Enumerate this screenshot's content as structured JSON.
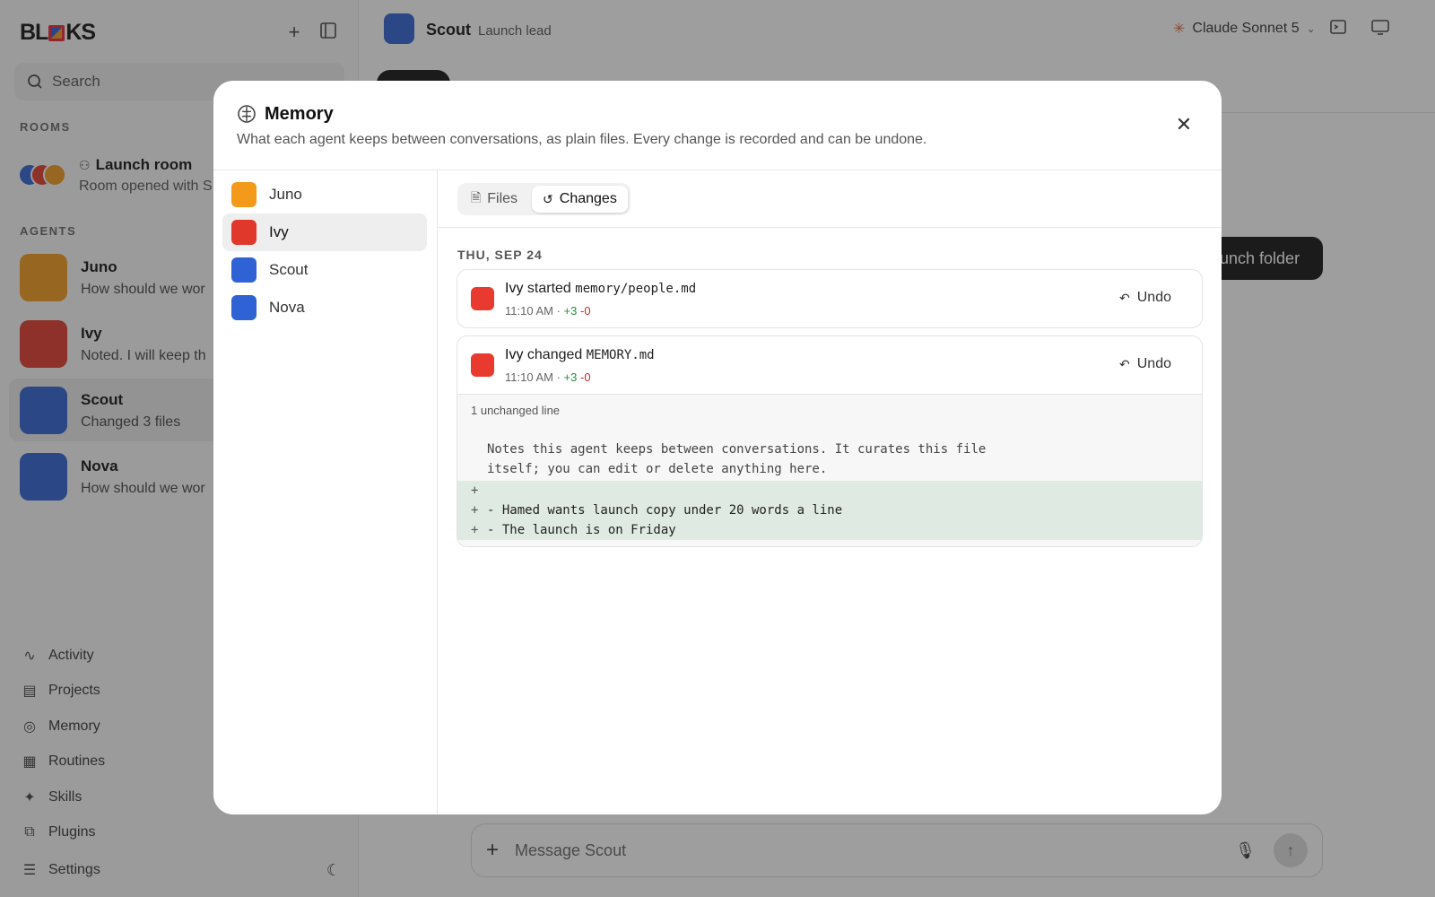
{
  "app": {
    "logo": "BLOKS"
  },
  "sidebar": {
    "search_placeholder": "Search",
    "rooms_label": "ROOMS",
    "room": {
      "name": "Launch room",
      "preview": "Room opened with S"
    },
    "agents_label": "AGENTS",
    "agents": [
      {
        "name": "Juno",
        "preview": "How should we wor",
        "color": "#f39a1a"
      },
      {
        "name": "Ivy",
        "preview": "Noted. I will keep th",
        "color": "#e0392c"
      },
      {
        "name": "Scout",
        "preview": "Changed 3 files",
        "color": "#2f62d4"
      },
      {
        "name": "Nova",
        "preview": "How should we wor",
        "color": "#2f62d4"
      }
    ],
    "nav": [
      "Activity",
      "Projects",
      "Memory",
      "Routines",
      "Skills",
      "Plugins",
      "Settings"
    ]
  },
  "chat": {
    "agent_name": "Scout",
    "agent_role": "Launch lead",
    "model": "Claude Sonnet 5",
    "bubble_text": "unch folder",
    "composer_placeholder": "Message Scout"
  },
  "modal": {
    "title": "Memory",
    "subtitle": "What each agent keeps between conversations, as plain files. Every change is recorded and can be undone.",
    "agents": [
      "Juno",
      "Ivy",
      "Scout",
      "Nova"
    ],
    "tabs": [
      "Files",
      "Changes"
    ],
    "date": "THU, SEP 24",
    "changes": [
      {
        "agent": "Ivy",
        "verb": "started",
        "file": "memory/people.md",
        "time": "11:10 AM ·",
        "added": "+3",
        "removed": "-0",
        "undo": "Undo"
      },
      {
        "agent": "Ivy",
        "verb": "changed",
        "file": "MEMORY.md",
        "time": "11:10 AM ·",
        "added": "+3",
        "removed": "-0",
        "undo": "Undo"
      }
    ],
    "diff": {
      "unchanged": "1 unchanged line",
      "context": [
        "Notes this agent keeps between conversations. It curates this file",
        "itself; you can edit or delete anything here."
      ],
      "added": [
        "",
        "- Hamed wants launch copy under 20 words a line",
        "- The launch is on Friday"
      ],
      "add_marker": "+"
    }
  }
}
